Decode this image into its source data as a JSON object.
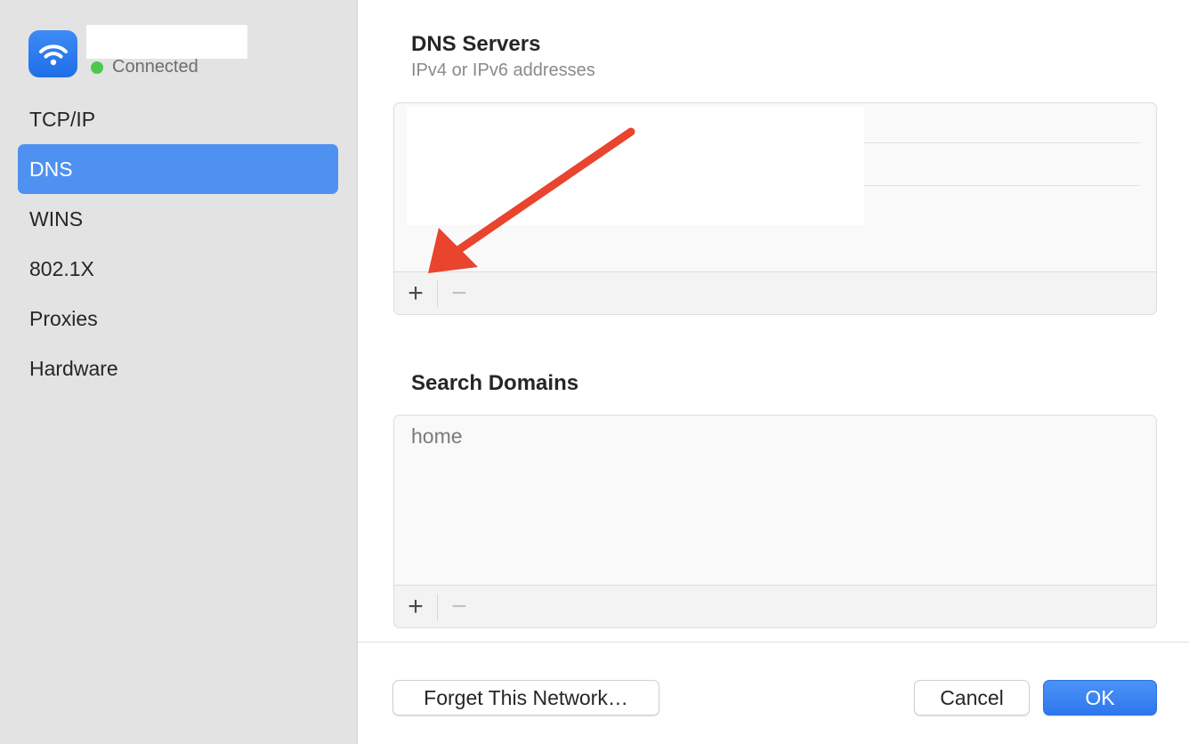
{
  "network": {
    "status": "Connected",
    "icon": "wifi-icon",
    "status_color": "#4cc94f"
  },
  "sidebar": {
    "items": [
      {
        "label": "TCP/IP"
      },
      {
        "label": "DNS",
        "selected": true
      },
      {
        "label": "WINS"
      },
      {
        "label": "802.1X"
      },
      {
        "label": "Proxies"
      },
      {
        "label": "Hardware"
      }
    ],
    "selected_color": "#4f91f0"
  },
  "dns_servers": {
    "title": "DNS Servers",
    "subtitle": "IPv4 or IPv6 addresses",
    "add_label": "+",
    "remove_label": "−"
  },
  "search_domains": {
    "title": "Search Domains",
    "entries": [
      "home"
    ],
    "add_label": "+",
    "remove_label": "−"
  },
  "footer": {
    "forget_label": "Forget This Network…",
    "cancel_label": "Cancel",
    "ok_label": "OK"
  },
  "colors": {
    "accent": "#2d77ee",
    "annotation_arrow": "#e8442e"
  }
}
